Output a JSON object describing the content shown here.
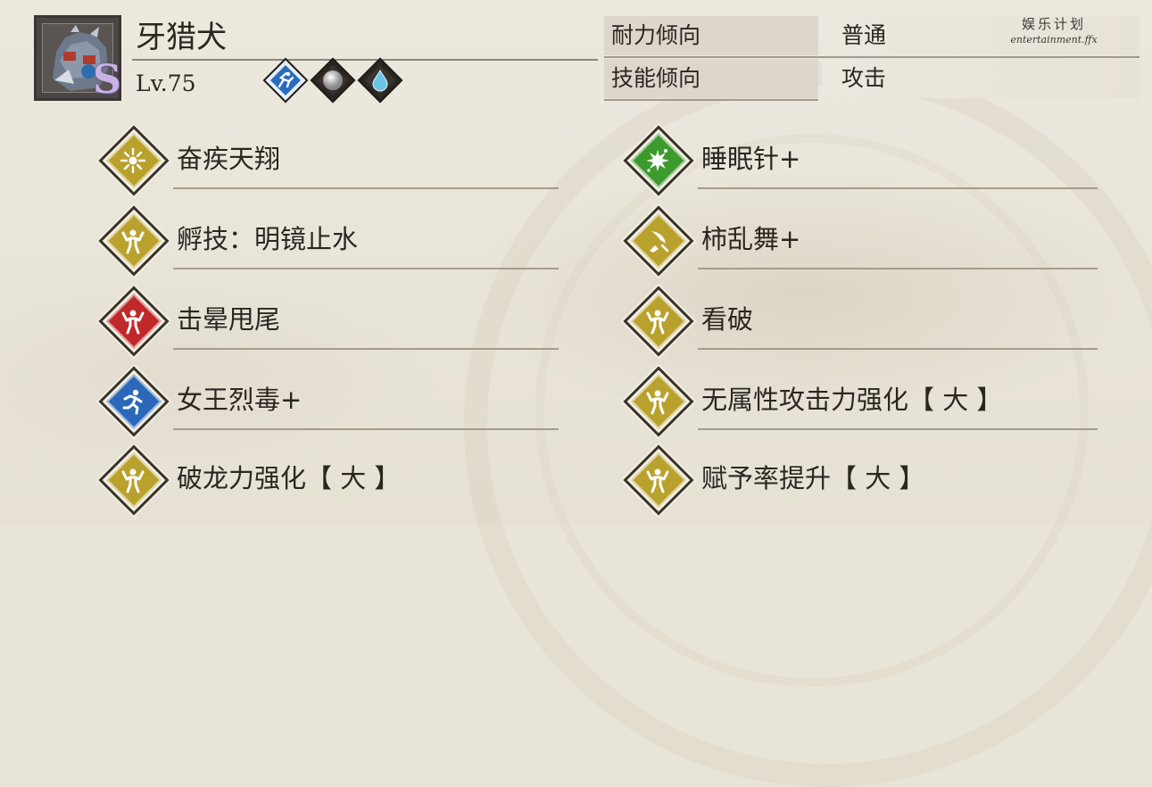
{
  "character": {
    "name": "牙猎犬",
    "rank": "S",
    "level": "Lv.75",
    "portrait_icon": "monster-portrait-icon",
    "elements": [
      {
        "icon": "paralysis-element-icon",
        "color": "#2a6bbf"
      },
      {
        "icon": "neutral-orb-element-icon",
        "color": "#bdbdbd"
      },
      {
        "icon": "water-drop-element-icon",
        "color": "#5ab4d6"
      }
    ]
  },
  "tendencies": [
    {
      "key": "耐力倾向",
      "value": "普通"
    },
    {
      "key": "技能倾向",
      "value": "攻击"
    }
  ],
  "watermark": {
    "line1": "娱乐计划",
    "line2": "entertainment.ffx"
  },
  "skills": {
    "left": [
      {
        "label": "奋疾天翔",
        "color": "#b9a12d",
        "icon": "sunburst-icon"
      },
      {
        "label": "孵技：明镜止水",
        "color": "#b9a12d",
        "icon": "strength-figure-icon"
      },
      {
        "label": "击晕甩尾",
        "color": "#c0282a",
        "icon": "strength-figure-icon"
      },
      {
        "label": "女王烈毒+",
        "color": "#2b68b9",
        "icon": "running-figure-icon"
      },
      {
        "label": "破龙力强化【 大 】",
        "color": "#b9a12d",
        "icon": "strength-figure-icon"
      }
    ],
    "right": [
      {
        "label": "睡眠针+",
        "color": "#3d9a2c",
        "icon": "burst-icon"
      },
      {
        "label": "柿乱舞+",
        "color": "#b9a12d",
        "icon": "slash-icon"
      },
      {
        "label": "看破",
        "color": "#b9a12d",
        "icon": "strength-figure-icon"
      },
      {
        "label": "无属性攻击力强化【 大 】",
        "color": "#b9a12d",
        "icon": "strength-figure-icon"
      },
      {
        "label": "赋予率提升【 大 】",
        "color": "#b9a12d",
        "icon": "strength-figure-icon"
      }
    ]
  }
}
